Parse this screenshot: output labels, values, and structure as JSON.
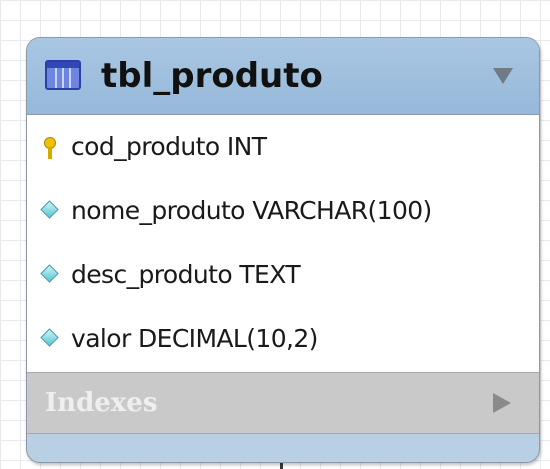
{
  "table": {
    "name": "tbl_produto",
    "columns": [
      {
        "label": "cod_produto INT",
        "key": "primary",
        "icon": "key-icon"
      },
      {
        "label": "nome_produto VARCHAR(100)",
        "key": "none",
        "icon": "diamond-icon"
      },
      {
        "label": "desc_produto TEXT",
        "key": "none",
        "icon": "diamond-icon"
      },
      {
        "label": "valor DECIMAL(10,2)",
        "key": "none",
        "icon": "diamond-icon"
      }
    ],
    "indexes_label": "Indexes"
  },
  "colors": {
    "header": "#a9c7e3",
    "indexes_band": "#c9c9c9",
    "primary_key": "#f2c200",
    "column_marker": "#5ec5cf"
  }
}
